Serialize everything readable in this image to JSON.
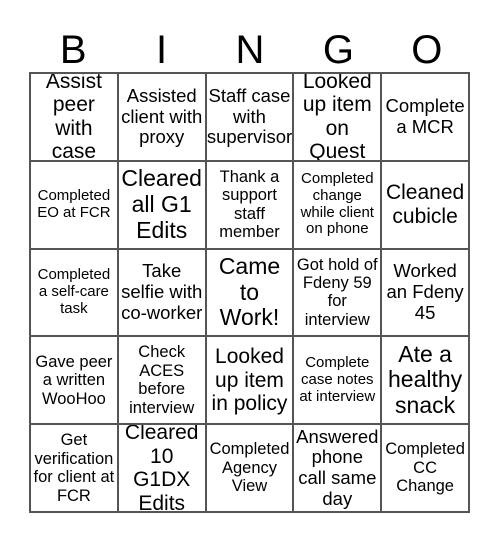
{
  "title_letters": [
    "B",
    "I",
    "N",
    "G",
    "O"
  ],
  "cells": [
    [
      "Assist peer with case",
      "Assisted client with proxy",
      "Staff case with supervisor",
      "Looked up item on Quest",
      "Complete a MCR"
    ],
    [
      "Completed EO at FCR",
      "Cleared all G1 Edits",
      "Thank a support staff member",
      "Completed change while client on phone",
      "Cleaned cubicle"
    ],
    [
      "Completed a self-care task",
      "Take selfie with co-worker",
      "Came to Work!",
      "Got hold of Fdeny 59 for interview",
      "Worked an Fdeny 45"
    ],
    [
      "Gave peer a written WooHoo",
      "Check ACES before interview",
      "Looked up item in policy",
      "Complete case notes at interview",
      "Ate a healthy snack"
    ],
    [
      "Get verification for client at FCR",
      "Cleared 10 G1DX Edits",
      "Completed Agency View",
      "Answered phone call same day",
      "Completed CC Change"
    ]
  ]
}
